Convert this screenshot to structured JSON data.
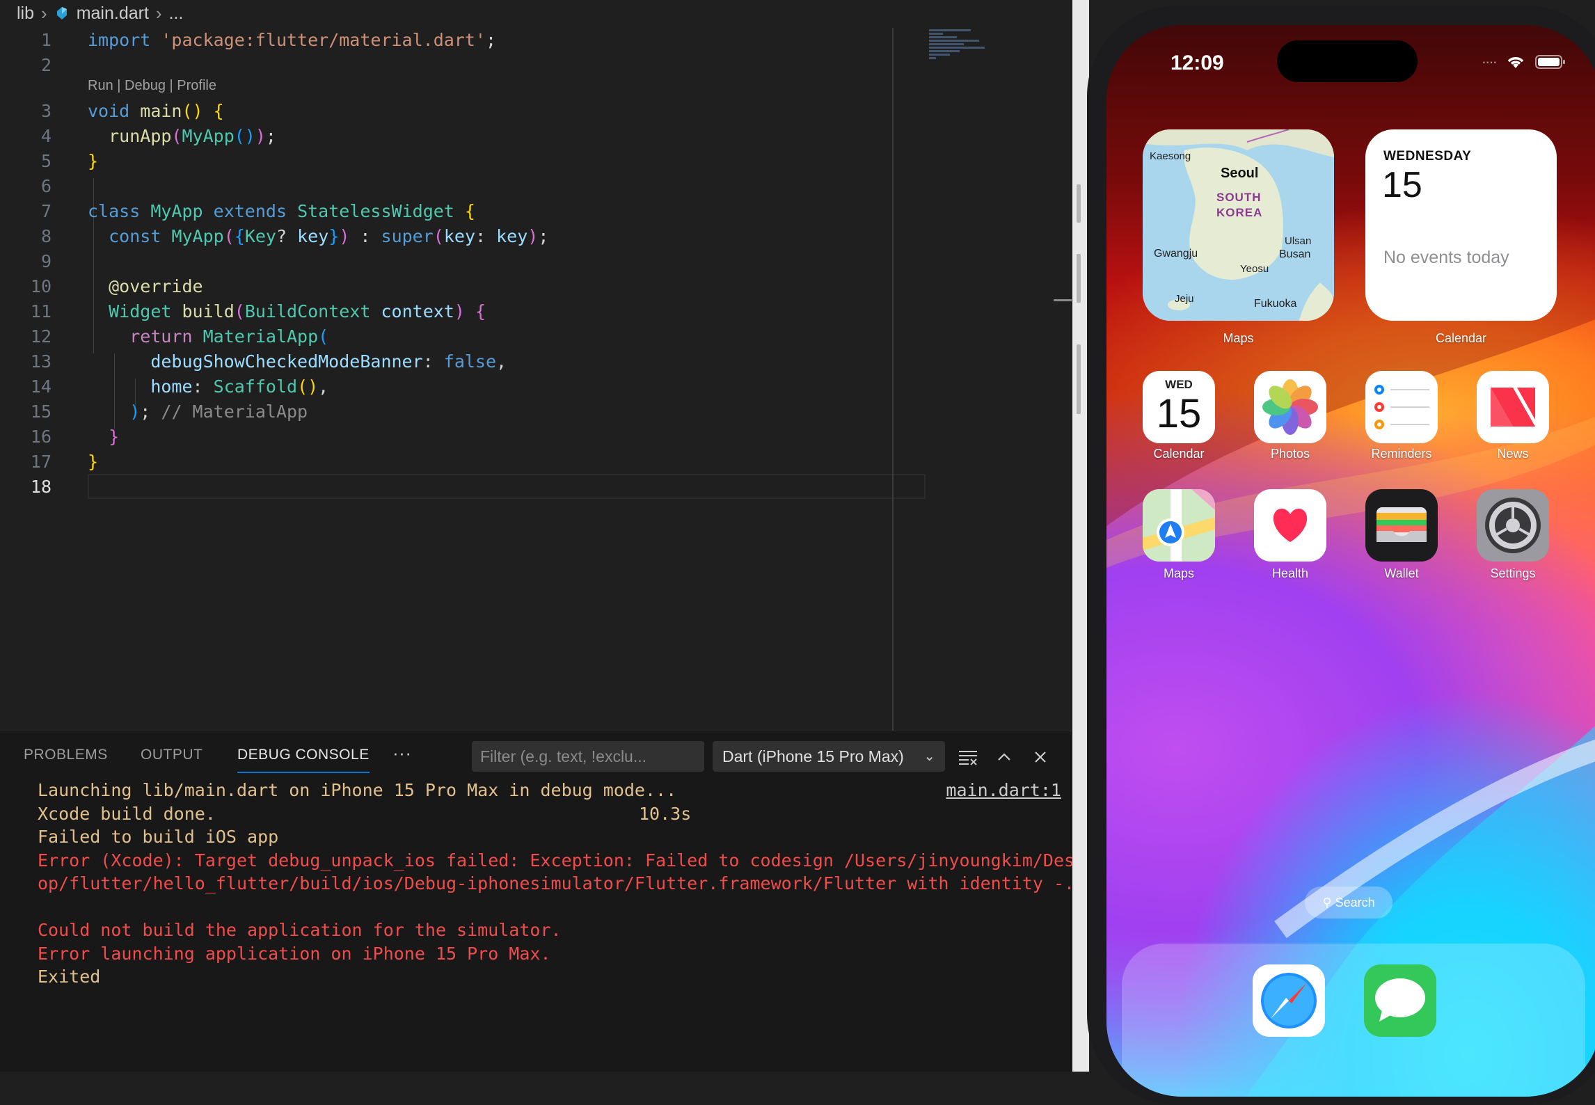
{
  "breadcrumb": {
    "folder": "lib",
    "file": "main.dart",
    "more": "..."
  },
  "editor": {
    "codelens": {
      "run": "Run",
      "debug": "Debug",
      "profile": "Profile",
      "sep": " | "
    },
    "line_numbers": [
      "1",
      "2",
      "3",
      "4",
      "5",
      "6",
      "7",
      "8",
      "9",
      "10",
      "11",
      "12",
      "13",
      "14",
      "15",
      "16",
      "17",
      "18"
    ],
    "comment_material_app": "// MaterialApp"
  },
  "panel": {
    "tabs": [
      "PROBLEMS",
      "OUTPUT",
      "DEBUG CONSOLE"
    ],
    "more": "···",
    "filter_placeholder": "Filter (e.g. text, !exclu...",
    "session": "Dart (iPhone 15 Pro Max)",
    "console_source_link": "main.dart:1",
    "console_time": "10.3s",
    "console_lines": [
      "Launching lib/main.dart on iPhone 15 Pro Max in debug mode...",
      "Xcode build done.",
      "Failed to build iOS app",
      "Error (Xcode): Target debug_unpack_ios failed: Exception: Failed to codesign /Users/jinyoungkim/Deskt",
      "op/flutter/hello_flutter/build/ios/Debug-iphonesimulator/Flutter.framework/Flutter with identity -.",
      "",
      "Could not build the application for the simulator.",
      "Error launching application on iPhone 15 Pro Max.",
      "Exited"
    ]
  },
  "phone": {
    "time": "12:09",
    "widgets": {
      "maps": {
        "label": "Maps",
        "places": [
          "Kaesong",
          "Seoul",
          "SOUTH",
          "KOREA",
          "Gwangju",
          "Ulsan",
          "Busan",
          "Yeosu",
          "Jeju",
          "Fukuoka"
        ]
      },
      "calendar": {
        "label": "Calendar",
        "day": "WEDNESDAY",
        "date": "15",
        "events": "No events today"
      }
    },
    "apps": [
      {
        "label": "Calendar",
        "icon": "calendar-icon",
        "day": "WED",
        "date": "15"
      },
      {
        "label": "Photos",
        "icon": "photos-icon"
      },
      {
        "label": "Reminders",
        "icon": "reminders-icon"
      },
      {
        "label": "News",
        "icon": "news-icon"
      },
      {
        "label": "Maps",
        "icon": "maps-icon"
      },
      {
        "label": "Health",
        "icon": "health-icon"
      },
      {
        "label": "Wallet",
        "icon": "wallet-icon"
      },
      {
        "label": "Settings",
        "icon": "settings-icon"
      }
    ],
    "search": "Search",
    "dock": [
      {
        "icon": "safari-icon"
      },
      {
        "icon": "messages-icon"
      }
    ]
  },
  "colors": {
    "vscode_bg": "#1f1f1f",
    "panel_bg": "#181818",
    "accent": "#0078d4",
    "error_red": "#f14c4c",
    "warn_yellow": "#e2c08d"
  }
}
